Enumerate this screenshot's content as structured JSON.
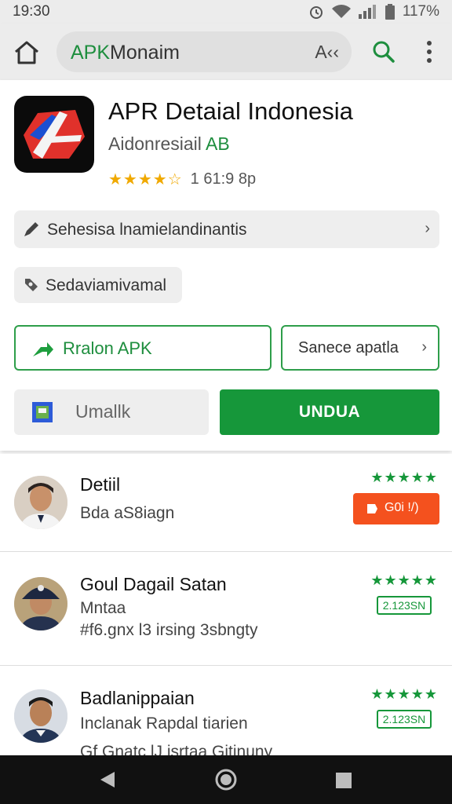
{
  "status_bar": {
    "time": "19:30",
    "battery": "117%"
  },
  "browser": {
    "url_prefix": "APK",
    "url_rest": "Monaim",
    "reader_label": "A‹‹"
  },
  "app": {
    "title": "APR Detaial Indonesia",
    "developer_prefix": "Aidonresiail ",
    "developer_suffix": "AB",
    "stars": "★★★★☆",
    "rating_count": "1 61:9 8p",
    "info_text": "Sehesisa lnamielandinantis",
    "chip_text": "Sedaviamivamal",
    "apk_button": "Rralon APK",
    "side_button": "Sanece apatla",
    "grey_button": "Umallk",
    "download_button": "UNDUA"
  },
  "reviews": [
    {
      "name": "Detiil",
      "line1": "Bda aS8iagn",
      "line2": "",
      "stars": "★★★★★",
      "badge": "G0i !/)"
    },
    {
      "name": "Goul Dagail Satan",
      "line1": "Mntaa",
      "line2": "#f6.gnx l3 irsing 3sbngty",
      "stars": "★★★★★",
      "badge": "2.123SN"
    },
    {
      "name": "Badlanippaian",
      "line1": "Inclanak Rapdal tiarien",
      "line2": "Gf Gnatc lJ isrtaa Gitinuny",
      "stars": "★★★★★",
      "badge": "2.123SN"
    }
  ],
  "colors": {
    "brand_green": "#16973a",
    "accent_orange": "#f4511e",
    "star_gold": "#f0a900"
  },
  "icons": [
    "home-icon",
    "search-icon",
    "more-vert-icon",
    "pencil-icon",
    "tag-icon",
    "arrow-right-icon",
    "chevron-right-icon",
    "image-icon",
    "play-icon",
    "nav-back-icon",
    "nav-home-icon",
    "nav-recent-icon"
  ]
}
